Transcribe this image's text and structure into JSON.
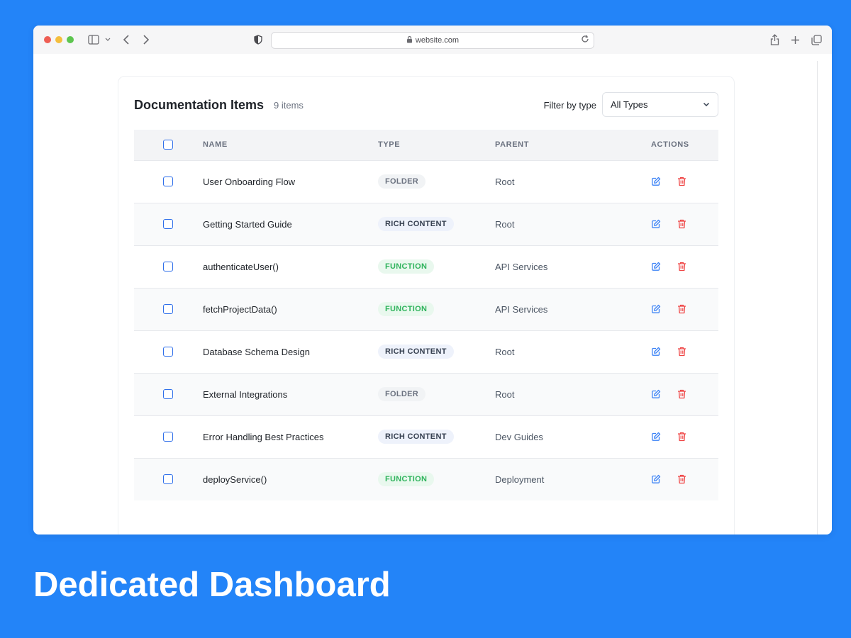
{
  "browser": {
    "url": "website.com"
  },
  "panel": {
    "title": "Documentation Items",
    "count": "9 items",
    "filter_label": "Filter by type",
    "filter_value": "All Types"
  },
  "table": {
    "headers": {
      "name": "NAME",
      "type": "TYPE",
      "parent": "PARENT",
      "actions": "ACTIONS"
    },
    "rows": [
      {
        "name": "User Onboarding Flow",
        "type": "FOLDER",
        "type_kind": "folder",
        "parent": "Root"
      },
      {
        "name": "Getting Started Guide",
        "type": "RICH CONTENT",
        "type_kind": "rich",
        "parent": "Root"
      },
      {
        "name": "authenticateUser()",
        "type": "FUNCTION",
        "type_kind": "func",
        "parent": "API Services"
      },
      {
        "name": "fetchProjectData()",
        "type": "FUNCTION",
        "type_kind": "func",
        "parent": "API Services"
      },
      {
        "name": "Database Schema Design",
        "type": "RICH CONTENT",
        "type_kind": "rich",
        "parent": "Root"
      },
      {
        "name": "External Integrations",
        "type": "FOLDER",
        "type_kind": "folder",
        "parent": "Root"
      },
      {
        "name": "Error Handling Best Practices",
        "type": "RICH CONTENT",
        "type_kind": "rich",
        "parent": "Dev Guides"
      },
      {
        "name": "deployService()",
        "type": "FUNCTION",
        "type_kind": "func",
        "parent": "Deployment"
      }
    ]
  },
  "icons": {
    "edit": "pencil-square-icon",
    "delete": "trash-icon"
  },
  "colors": {
    "background": "#2384f8",
    "edit_icon": "#3b82f6",
    "delete_icon": "#ef4444",
    "function_badge": "#2fb35c"
  },
  "caption": "Dedicated Dashboard"
}
